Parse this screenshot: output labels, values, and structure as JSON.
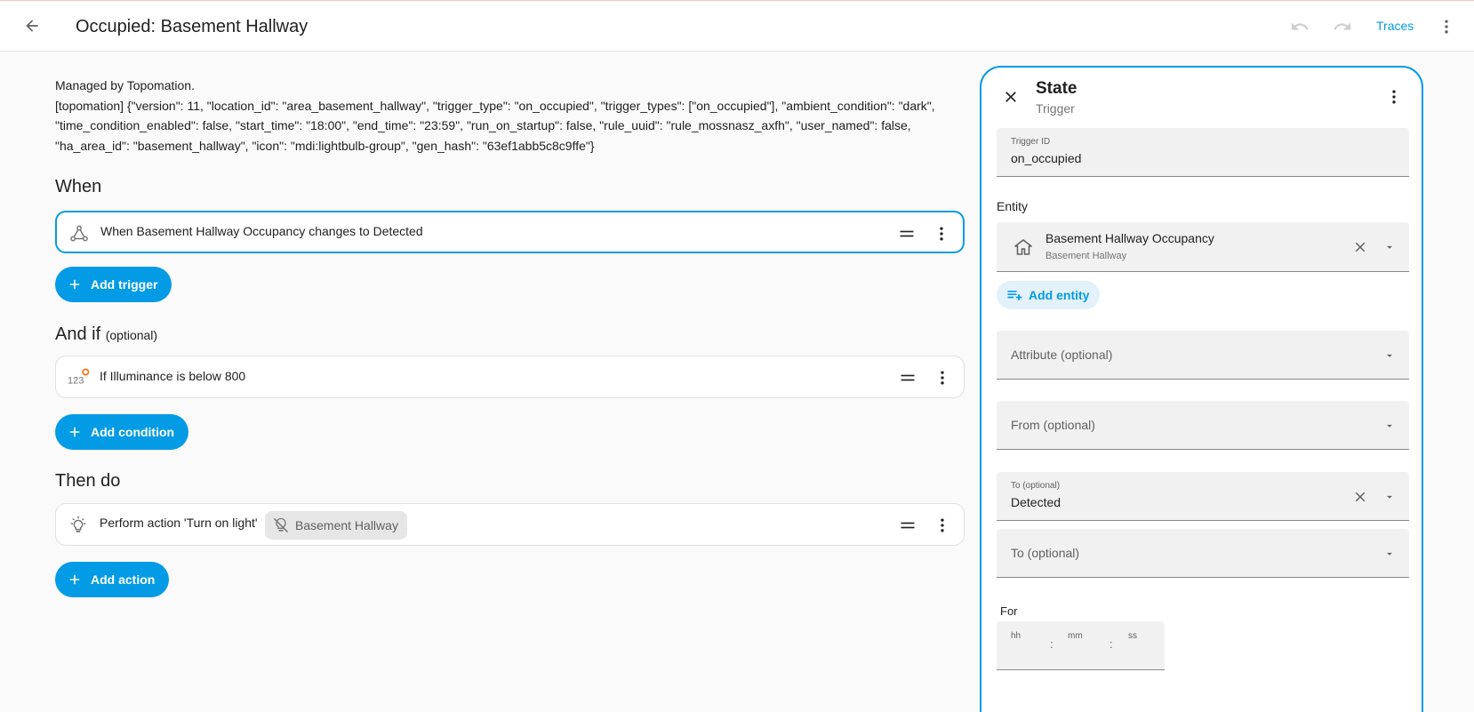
{
  "header": {
    "title": "Occupied: Basement Hallway",
    "traces_label": "Traces"
  },
  "description": {
    "line1": "Managed by Topomation.",
    "line2": "[topomation] {\"version\": 11, \"location_id\": \"area_basement_hallway\", \"trigger_type\": \"on_occupied\", \"trigger_types\": [\"on_occupied\"], \"ambient_condition\": \"dark\", \"time_condition_enabled\": false, \"start_time\": \"18:00\", \"end_time\": \"23:59\", \"run_on_startup\": false, \"rule_uuid\": \"rule_mossnasz_axfh\", \"user_named\": false, \"ha_area_id\": \"basement_hallway\", \"icon\": \"mdi:lightbulb-group\", \"gen_hash\": \"63ef1abb5c8c9ffe\"}"
  },
  "sections": {
    "when": {
      "title": "When",
      "trigger_text": "When Basement Hallway Occupancy changes to Detected",
      "add_label": "Add trigger"
    },
    "and_if": {
      "title": "And if",
      "optional": "(optional)",
      "condition_text": "If Illuminance is below 800",
      "add_label": "Add condition"
    },
    "then_do": {
      "title": "Then do",
      "action_text": "Perform action 'Turn on light'",
      "target_chip": "Basement Hallway",
      "add_label": "Add action"
    }
  },
  "panel": {
    "title": "State",
    "subtitle": "Trigger",
    "trigger_id_label": "Trigger ID",
    "trigger_id_value": "on_occupied",
    "entity_label": "Entity",
    "entity_name": "Basement Hallway Occupancy",
    "entity_area": "Basement Hallway",
    "add_entity_label": "Add entity",
    "attribute_placeholder": "Attribute (optional)",
    "from_placeholder": "From (optional)",
    "to_label": "To (optional)",
    "to_value": "Detected",
    "to2_placeholder": "To (optional)",
    "for_label": "For",
    "duration": {
      "hh": "hh",
      "mm": "mm",
      "ss": "ss",
      "sep": ":"
    }
  },
  "colors": {
    "accent": "#039be5",
    "card_border": "#e0e0e0",
    "field_bg": "#f1f1f1",
    "condition_badge": "#ff6d00"
  }
}
